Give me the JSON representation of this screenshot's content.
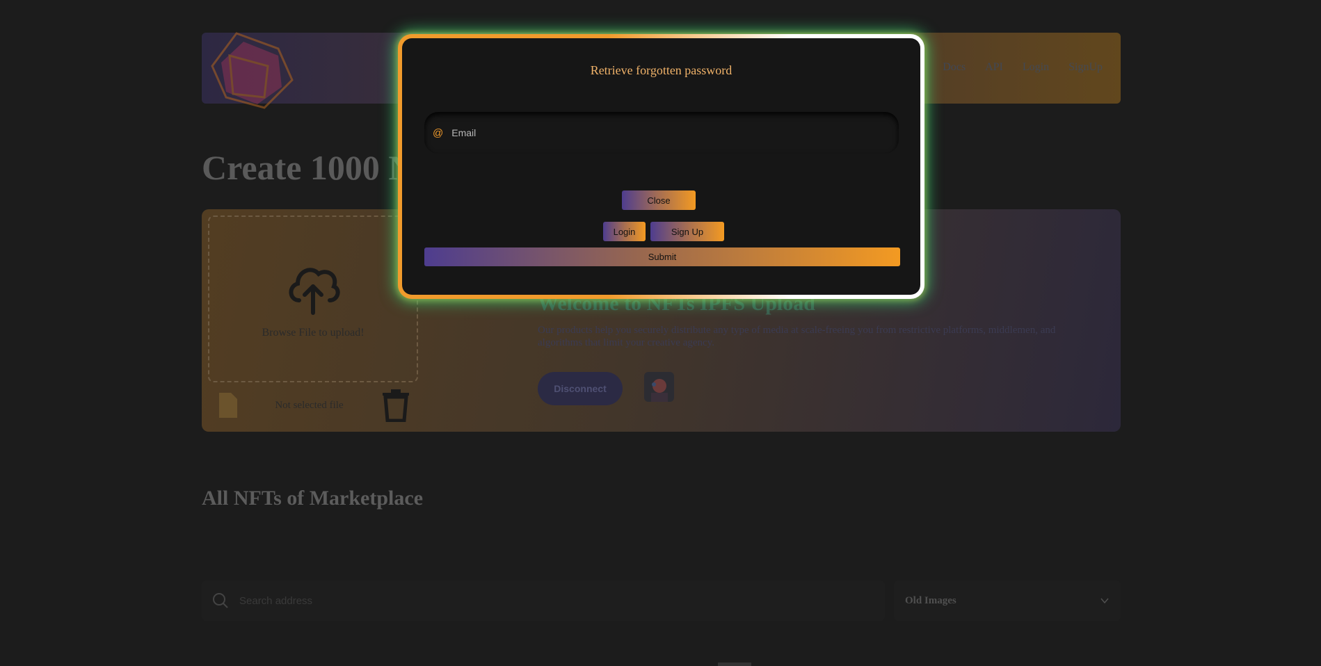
{
  "nav": {
    "items": [
      "Docs",
      "API",
      "Login",
      "SignUp"
    ]
  },
  "main": {
    "heading": "Create 1000 N",
    "upload": {
      "label": "Browse File to upload!",
      "file_status": "Not selected file"
    },
    "hero": {
      "title": "Welcome to NFTs IPFS Upload",
      "text": "Our products help you securely distribute any type of media at scale-freeing you from restrictive platforms, middlemen, and algorithms that limit your creative agency.",
      "disconnect_label": "Disconnect"
    },
    "marketplace_heading": "All NFTs of Marketplace",
    "search": {
      "placeholder": "Search address"
    },
    "sort_select": {
      "value": "Old Images"
    }
  },
  "modal": {
    "title": "Retrieve forgotten password",
    "email": {
      "icon": "@",
      "placeholder": "Email",
      "value": ""
    },
    "close_label": "Close",
    "login_label": "Login",
    "signup_label": "Sign Up",
    "submit_label": "Submit"
  },
  "colors": {
    "accent_orange": "#f19b2c",
    "accent_purple": "#4e3d8f",
    "modal_glow": "#3cdc78",
    "background": "#1c1c1c"
  }
}
